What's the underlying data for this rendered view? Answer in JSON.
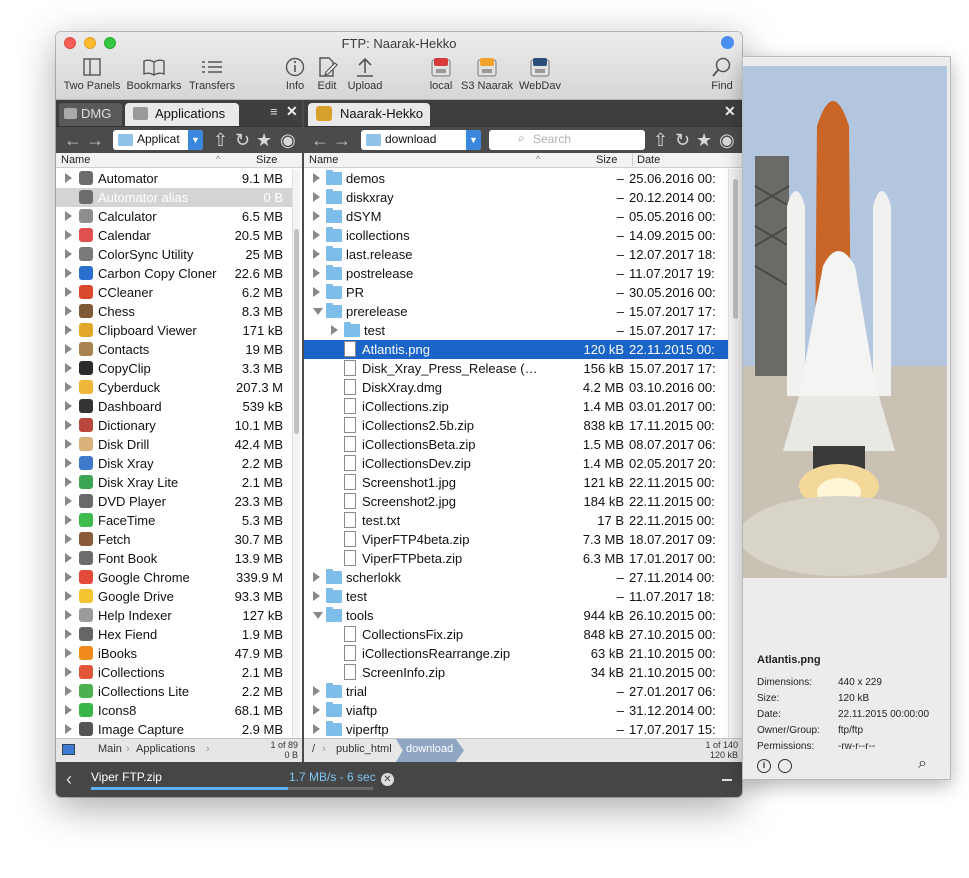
{
  "window": {
    "title": "FTP: Naarak-Hekko"
  },
  "toolbar": [
    {
      "label": "Two Panels",
      "icon": "two-panels-icon"
    },
    {
      "label": "Bookmarks",
      "icon": "bookmarks-icon"
    },
    {
      "label": "Transfers",
      "icon": "transfers-icon"
    },
    {
      "label": "Info",
      "icon": "info-icon"
    },
    {
      "label": "Edit",
      "icon": "edit-icon"
    },
    {
      "label": "Upload",
      "icon": "upload-icon"
    },
    {
      "label": "local",
      "icon": "ssh-local-icon"
    },
    {
      "label": "S3 Naarak",
      "icon": "s3-icon"
    },
    {
      "label": "WebDav",
      "icon": "webdav-icon"
    },
    {
      "label": "Find",
      "icon": "find-icon"
    }
  ],
  "left": {
    "tabs": [
      "DMG",
      "Applications"
    ],
    "path_label": "Applicat",
    "columns": {
      "name": "Name",
      "size": "Size"
    },
    "rows": [
      {
        "name": "Automator",
        "size": "9.1 MB",
        "color": "#6d6d6d"
      },
      {
        "name": "Automator alias",
        "size": "0 B",
        "color": "#6d6d6d"
      },
      {
        "name": "Calculator",
        "size": "6.5 MB",
        "color": "#8e8e8e"
      },
      {
        "name": "Calendar",
        "size": "20.5 MB",
        "color": "#e05050"
      },
      {
        "name": "ColorSync Utility",
        "size": "25 MB",
        "color": "#7a7a7a"
      },
      {
        "name": "Carbon Copy Cloner",
        "size": "22.6 MB",
        "color": "#2b6fcf"
      },
      {
        "name": "CCleaner",
        "size": "6.2 MB",
        "color": "#d94a2e"
      },
      {
        "name": "Chess",
        "size": "8.3 MB",
        "color": "#7e5a36"
      },
      {
        "name": "Clipboard Viewer",
        "size": "171 kB",
        "color": "#e3a72a"
      },
      {
        "name": "Contacts",
        "size": "19 MB",
        "color": "#a98252"
      },
      {
        "name": "CopyClip",
        "size": "3.3 MB",
        "color": "#2b2b2b"
      },
      {
        "name": "Cyberduck",
        "size": "207.3 M",
        "color": "#f0b63a"
      },
      {
        "name": "Dashboard",
        "size": "539 kB",
        "color": "#333333"
      },
      {
        "name": "Dictionary",
        "size": "10.1 MB",
        "color": "#b9473b"
      },
      {
        "name": "Disk Drill",
        "size": "42.4 MB",
        "color": "#d8b27a"
      },
      {
        "name": "Disk Xray",
        "size": "2.2 MB",
        "color": "#3f79c9"
      },
      {
        "name": "Disk Xray Lite",
        "size": "2.1 MB",
        "color": "#3aa553"
      },
      {
        "name": "DVD Player",
        "size": "23.3 MB",
        "color": "#6a6a6a"
      },
      {
        "name": "FaceTime",
        "size": "5.3 MB",
        "color": "#3fbc4e"
      },
      {
        "name": "Fetch",
        "size": "30.7 MB",
        "color": "#8a5a3a"
      },
      {
        "name": "Font Book",
        "size": "13.9 MB",
        "color": "#6d6d6d"
      },
      {
        "name": "Google Chrome",
        "size": "339.9 M",
        "color": "#e34a3a"
      },
      {
        "name": "Google Drive",
        "size": "93.3 MB",
        "color": "#f4c430"
      },
      {
        "name": "Help Indexer",
        "size": "127 kB",
        "color": "#9a9a9a"
      },
      {
        "name": "Hex Fiend",
        "size": "1.9 MB",
        "color": "#666666"
      },
      {
        "name": "iBooks",
        "size": "47.9 MB",
        "color": "#f08a1e"
      },
      {
        "name": "iCollections",
        "size": "2.1 MB",
        "color": "#e2573a"
      },
      {
        "name": "iCollections Lite",
        "size": "2.2 MB",
        "color": "#4cb050"
      },
      {
        "name": "Icons8",
        "size": "68.1 MB",
        "color": "#3ab54a"
      },
      {
        "name": "Image Capture",
        "size": "2.9 MB",
        "color": "#555555"
      }
    ],
    "crumbs": [
      "Main",
      "Applications"
    ],
    "count": {
      "line1": "1 of 89",
      "line2": "0 B"
    }
  },
  "right": {
    "tab": "Naarak-Hekko",
    "path_label": "download",
    "search_placeholder": "Search",
    "columns": {
      "name": "Name",
      "size": "Size",
      "date": "Date"
    },
    "rows": [
      {
        "name": "demos",
        "size": "–",
        "date": "25.06.2016 00:",
        "kind": "folder",
        "level": 0,
        "open": false
      },
      {
        "name": "diskxray",
        "size": "–",
        "date": "20.12.2014 00:",
        "kind": "folder",
        "level": 0,
        "open": false
      },
      {
        "name": "dSYM",
        "size": "–",
        "date": "05.05.2016 00:",
        "kind": "folder",
        "level": 0,
        "open": false
      },
      {
        "name": "icollections",
        "size": "–",
        "date": "14.09.2015 00:",
        "kind": "folder",
        "level": 0,
        "open": false
      },
      {
        "name": "last.release",
        "size": "–",
        "date": "12.07.2017 18:",
        "kind": "folder",
        "level": 0,
        "open": false
      },
      {
        "name": "postrelease",
        "size": "–",
        "date": "11.07.2017 19:",
        "kind": "folder",
        "level": 0,
        "open": false
      },
      {
        "name": "PR",
        "size": "–",
        "date": "30.05.2016 00:",
        "kind": "folder",
        "level": 0,
        "open": false
      },
      {
        "name": "prerelease",
        "size": "–",
        "date": "15.07.2017 17:",
        "kind": "folder",
        "level": 0,
        "open": true
      },
      {
        "name": "test",
        "size": "–",
        "date": "15.07.2017 17:",
        "kind": "folder",
        "level": 1,
        "open": false
      },
      {
        "name": "Atlantis.png",
        "size": "120 kB",
        "date": "22.11.2015 00:",
        "kind": "file",
        "level": 1,
        "selected": true
      },
      {
        "name": "Disk_Xray_Press_Release (1)....",
        "size": "156 kB",
        "date": "15.07.2017 17:",
        "kind": "file",
        "level": 1
      },
      {
        "name": "DiskXray.dmg",
        "size": "4.2 MB",
        "date": "03.10.2016 00:",
        "kind": "file",
        "level": 1
      },
      {
        "name": "iCollections.zip",
        "size": "1.4 MB",
        "date": "03.01.2017 00:",
        "kind": "file",
        "level": 1
      },
      {
        "name": "iCollections2.5b.zip",
        "size": "838 kB",
        "date": "17.11.2015 00:",
        "kind": "file",
        "level": 1
      },
      {
        "name": "iCollectionsBeta.zip",
        "size": "1.5 MB",
        "date": "08.07.2017 06:",
        "kind": "file",
        "level": 1
      },
      {
        "name": "iCollectionsDev.zip",
        "size": "1.4 MB",
        "date": "02.05.2017 20:",
        "kind": "file",
        "level": 1
      },
      {
        "name": "Screenshot1.jpg",
        "size": "121 kB",
        "date": "22.11.2015 00:",
        "kind": "file",
        "level": 1
      },
      {
        "name": "Screenshot2.jpg",
        "size": "184 kB",
        "date": "22.11.2015 00:",
        "kind": "file",
        "level": 1
      },
      {
        "name": "test.txt",
        "size": "17 B",
        "date": "22.11.2015 00:",
        "kind": "file",
        "level": 1
      },
      {
        "name": "ViperFTP4beta.zip",
        "size": "7.3 MB",
        "date": "18.07.2017 09:",
        "kind": "file",
        "level": 1
      },
      {
        "name": "ViperFTPbeta.zip",
        "size": "6.3 MB",
        "date": "17.01.2017 00:",
        "kind": "file",
        "level": 1
      },
      {
        "name": "scherlokk",
        "size": "–",
        "date": "27.11.2014 00:",
        "kind": "folder",
        "level": 0,
        "open": false
      },
      {
        "name": "test",
        "size": "–",
        "date": "11.07.2017 18:",
        "kind": "folder",
        "level": 0,
        "open": false
      },
      {
        "name": "tools",
        "size": "944 kB",
        "date": "26.10.2015 00:",
        "kind": "folder",
        "level": 0,
        "open": true
      },
      {
        "name": "CollectionsFix.zip",
        "size": "848 kB",
        "date": "27.10.2015 00:",
        "kind": "file",
        "level": 1
      },
      {
        "name": "iCollectionsRearrange.zip",
        "size": "63 kB",
        "date": "21.10.2015 00:",
        "kind": "file",
        "level": 1
      },
      {
        "name": "ScreenInfo.zip",
        "size": "34 kB",
        "date": "21.10.2015 00:",
        "kind": "file",
        "level": 1
      },
      {
        "name": "trial",
        "size": "–",
        "date": "27.01.2017 06:",
        "kind": "folder",
        "level": 0,
        "open": false
      },
      {
        "name": "viaftp",
        "size": "–",
        "date": "31.12.2014 00:",
        "kind": "folder",
        "level": 0,
        "open": false
      },
      {
        "name": "viperftp",
        "size": "–",
        "date": "17.07.2017 15:",
        "kind": "folder",
        "level": 0,
        "open": false
      }
    ],
    "crumbs": [
      "/",
      "public_html",
      "download"
    ],
    "count": {
      "line1": "1 of 140",
      "line2": "120 kB"
    }
  },
  "transfer": {
    "file": "Viper FTP.zip",
    "speed": "1.7 MB/s - 6 sec",
    "progress": 0.7
  },
  "preview": {
    "filename": "Atlantis.png",
    "fields": [
      {
        "label": "Dimensions:",
        "value": "440 x 229"
      },
      {
        "label": "Size:",
        "value": "120 kB"
      },
      {
        "label": "Date:",
        "value": "22.11.2015 00:00:00"
      },
      {
        "label": "Owner/Group:",
        "value": "ftp/ftp"
      },
      {
        "label": "Permissions:",
        "value": "-rw-r--r--"
      }
    ]
  },
  "colors": {
    "selection": "#1a64c8",
    "accent": "#4a8ef0",
    "progress": "#5bb2ee"
  }
}
